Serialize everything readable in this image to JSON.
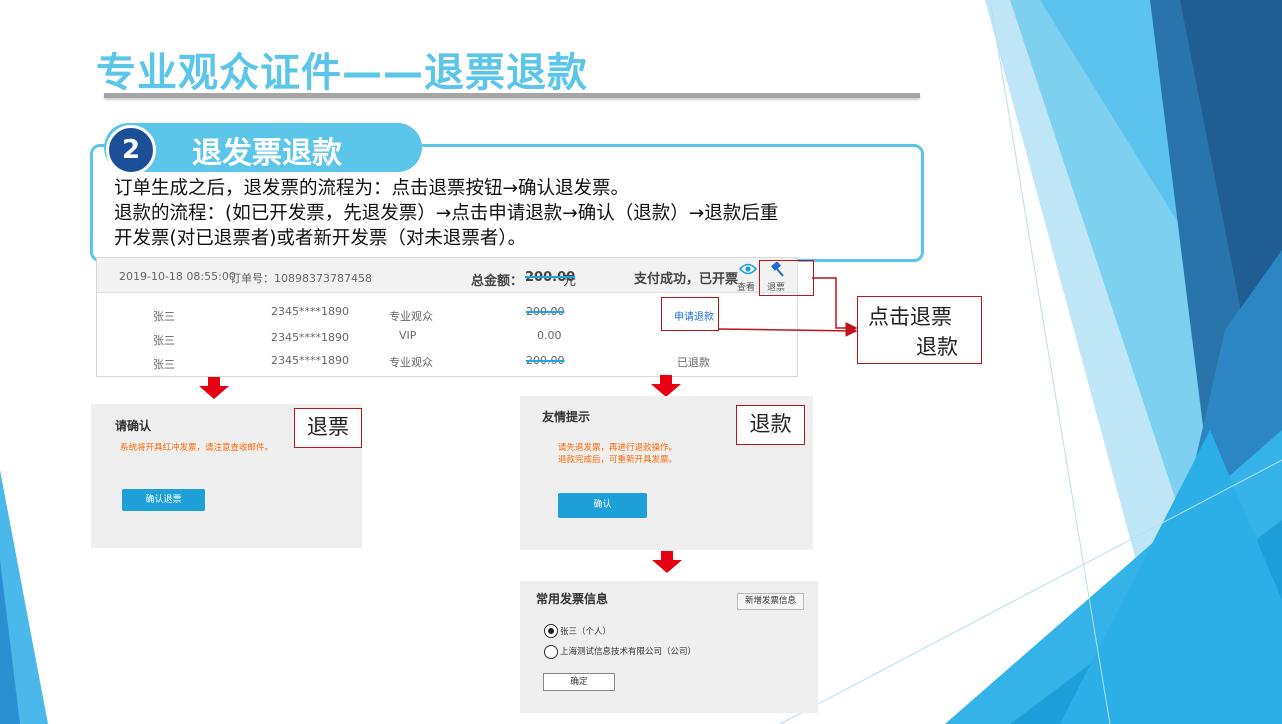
{
  "slide": {
    "title": "专业观众证件——退票退款",
    "step": {
      "number": "2",
      "title": "退发票退款",
      "lines": [
        "订单生成之后，退发票的流程为：点击退票按钮→确认退发票。",
        "退款的流程：(如已开发票，先退发票）→点击申请退款→确认（退款）→退款后重",
        "开发票(对已退票者)或者新开发票（对未退票者）。"
      ]
    }
  },
  "order": {
    "date": "2019-10-18 08:55:00",
    "order_no": "订单号：10898373787458",
    "total_label": "总金额：",
    "total_amount": "200.00",
    "total_unit": "元",
    "status": "支付成功，已开票",
    "view_label": "查看",
    "refund_ticket_label": "退票",
    "rows": [
      {
        "name": "张三",
        "phone": "2345****1890",
        "type": "专业观众",
        "amount": "200.00",
        "action": "申请退款"
      },
      {
        "name": "张三",
        "phone": "2345****1890",
        "type": "VIP",
        "amount": "0.00",
        "action": ""
      },
      {
        "name": "张三",
        "phone": "2345****1890",
        "type": "专业观众",
        "amount": "200.00",
        "action": "已退款"
      }
    ]
  },
  "callouts": {
    "click_refund_line1": "点击退票",
    "click_refund_line2": "退款",
    "refund_ticket": "退票",
    "refund_money": "退款"
  },
  "confirm_panel": {
    "title": "请确认",
    "message": "系统将开具红冲发票，请注意查收邮件。",
    "button": "确认退票"
  },
  "tip_panel": {
    "title": "友情提示",
    "message_line1": "请先退发票，再进行退款操作。",
    "message_line2": "退款完成后，可重新开具发票。",
    "button": "确认"
  },
  "invoice_panel": {
    "title": "常用发票信息",
    "add_button": "新增发票信息",
    "option1": "张三（个人）",
    "option2": "上海测试信息技术有限公司（公司）",
    "ok_button": "确定"
  },
  "colors": {
    "accent": "#5bc5ea",
    "dark_blue": "#1d4f99",
    "red": "#e60012",
    "link": "#1e6fd0",
    "warning": "#ff6600"
  }
}
